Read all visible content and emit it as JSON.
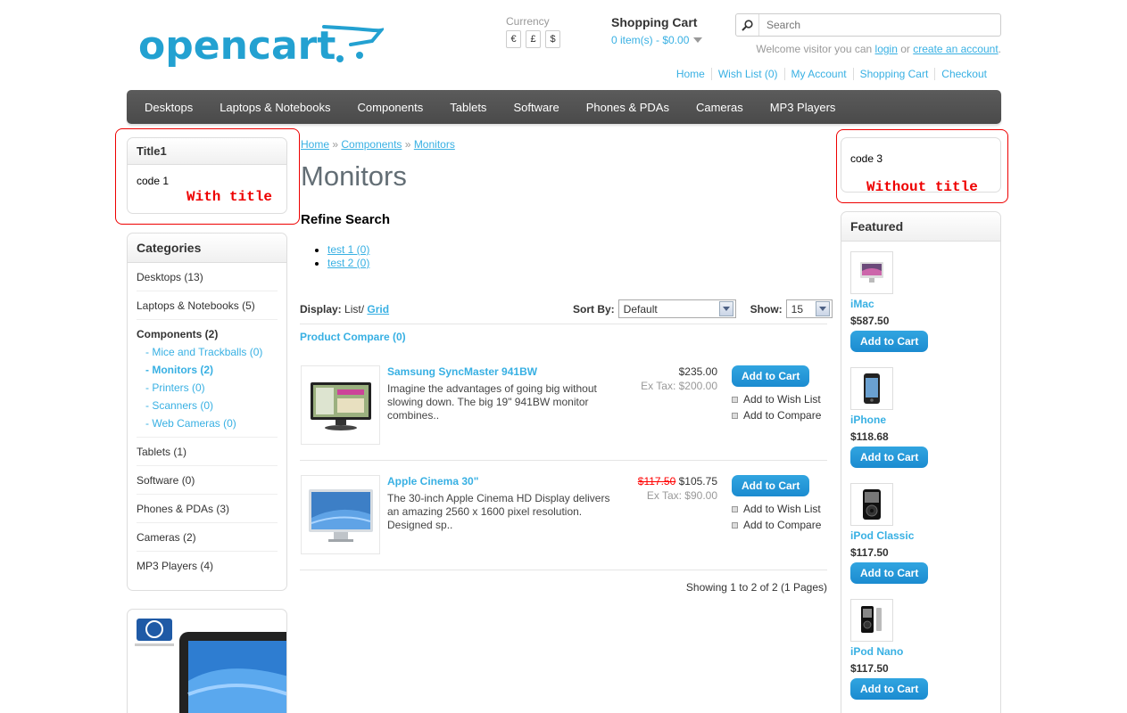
{
  "header": {
    "logo_text": "opencart",
    "currency_label": "Currency",
    "currencies": [
      "€",
      "£",
      "$"
    ],
    "cart_title": "Shopping Cart",
    "cart_total": "0 item(s) - $0.00",
    "search_placeholder": "Search",
    "welcome_prefix": "Welcome visitor you can",
    "login_label": "login",
    "welcome_or": "or",
    "create_account_label": "create an account",
    "welcome_suffix": ".",
    "links": [
      "Home",
      "Wish List (0)",
      "My Account",
      "Shopping Cart",
      "Checkout"
    ]
  },
  "menu": [
    "Desktops",
    "Laptops & Notebooks",
    "Components",
    "Tablets",
    "Software",
    "Phones & PDAs",
    "Cameras",
    "MP3 Players"
  ],
  "left": {
    "title_box": {
      "title": "Title1",
      "code": "code 1",
      "note": "With title"
    },
    "categories": {
      "title": "Categories",
      "items": [
        "Desktops (13)",
        "Laptops & Notebooks (5)",
        "Components (2)",
        "Tablets (1)",
        "Software (0)",
        "Phones & PDAs (3)",
        "Cameras (2)",
        "MP3 Players (4)"
      ],
      "subitems": [
        "- Mice and Trackballs (0)",
        "- Monitors (2)",
        "- Printers (0)",
        "- Scanners (0)",
        "- Web Cameras (0)"
      ]
    }
  },
  "content": {
    "breadcrumb": [
      "Home",
      "Components",
      "Monitors"
    ],
    "breadcrumb_sep": "»",
    "title": "Monitors",
    "refine_title": "Refine Search",
    "refine_items": [
      "test 1 (0)",
      "test 2 (0)"
    ],
    "display_label": "Display:",
    "display_list": "List",
    "display_sep": "/",
    "display_grid": "Grid",
    "sort_label": "Sort By:",
    "sort_value": "Default",
    "show_label": "Show:",
    "show_value": "15",
    "compare_link": "Product Compare (0)",
    "products": [
      {
        "name": "Samsung SyncMaster 941BW",
        "description": "Imagine the advantages of going big without slowing down. The big 19\" 941BW monitor combines..",
        "price": "$235.00",
        "old_price": "",
        "ex_tax": "Ex Tax: $200.00",
        "cart_label": "Add to Cart",
        "wishlist_label": "Add to Wish List",
        "compare_label": "Add to Compare"
      },
      {
        "name": "Apple Cinema 30\"",
        "description": "The 30-inch Apple Cinema HD Display delivers an amazing 2560 x 1600 pixel resolution. Designed sp..",
        "price": "$105.75",
        "old_price": "$117.50",
        "ex_tax": "Ex Tax: $90.00",
        "cart_label": "Add to Cart",
        "wishlist_label": "Add to Wish List",
        "compare_label": "Add to Compare"
      }
    ],
    "pagination": "Showing 1 to 2 of 2 (1 Pages)"
  },
  "right": {
    "code_box": {
      "code": "code 3",
      "note": "Without title"
    },
    "featured": {
      "title": "Featured",
      "items": [
        {
          "name": "iMac",
          "price": "$587.50",
          "cart_label": "Add to Cart"
        },
        {
          "name": "iPhone",
          "price": "$118.68",
          "cart_label": "Add to Cart"
        },
        {
          "name": "iPod Classic",
          "price": "$117.50",
          "cart_label": "Add to Cart"
        },
        {
          "name": "iPod Nano",
          "price": "$117.50",
          "cart_label": "Add to Cart"
        }
      ]
    }
  },
  "colors": {
    "accent": "#38b0e3",
    "menu": "#505050",
    "annotation": "#e00000",
    "button": "#1e90d6"
  }
}
